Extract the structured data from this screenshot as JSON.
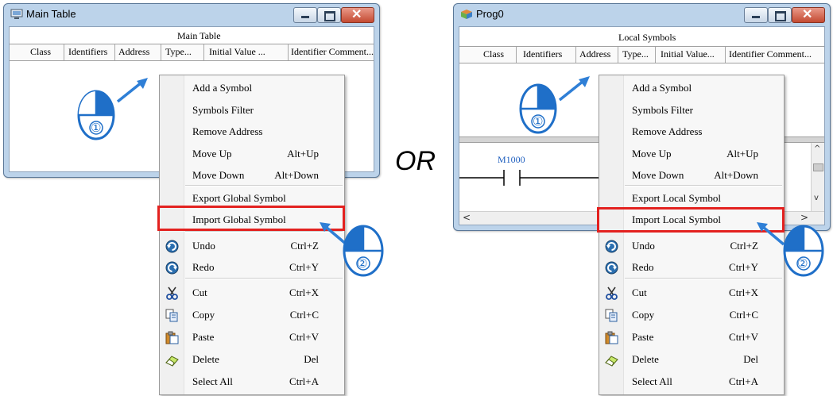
{
  "left_window": {
    "title": "Main Table",
    "header": "Main Table",
    "columns": [
      "Class",
      "Identifiers",
      "Address",
      "Type...",
      "Initial Value ...",
      "Identifier Comment..."
    ]
  },
  "right_window": {
    "title": "Prog0",
    "header": "Local Symbols",
    "columns": [
      "Class",
      "Identifiers",
      "Address",
      "Type...",
      "Initial Value...",
      "Identifier Comment..."
    ],
    "ladder_label": "M1000"
  },
  "separator_text": "OR",
  "left_menu": {
    "items": [
      {
        "label": "Add a Symbol",
        "shortcut": ""
      },
      {
        "label": "Symbols Filter",
        "shortcut": ""
      },
      {
        "label": "Remove Address",
        "shortcut": ""
      },
      {
        "label": "Move Up",
        "shortcut": "Alt+Up"
      },
      {
        "label": "Move Down",
        "shortcut": "Alt+Down"
      },
      {
        "label": "Export Global Symbol",
        "shortcut": ""
      },
      {
        "label": "Import Global Symbol",
        "shortcut": ""
      },
      {
        "label": "Undo",
        "shortcut": "Ctrl+Z",
        "icon": "undo-icon"
      },
      {
        "label": "Redo",
        "shortcut": "Ctrl+Y",
        "icon": "redo-icon"
      },
      {
        "label": "Cut",
        "shortcut": "Ctrl+X",
        "icon": "scissors-icon"
      },
      {
        "label": "Copy",
        "shortcut": "Ctrl+C",
        "icon": "copy-icon"
      },
      {
        "label": "Paste",
        "shortcut": "Ctrl+V",
        "icon": "paste-icon"
      },
      {
        "label": "Delete",
        "shortcut": "Del",
        "icon": "eraser-icon"
      },
      {
        "label": "Select All",
        "shortcut": "Ctrl+A"
      }
    ]
  },
  "right_menu": {
    "items": [
      {
        "label": "Add a Symbol",
        "shortcut": ""
      },
      {
        "label": "Symbols Filter",
        "shortcut": ""
      },
      {
        "label": "Remove Address",
        "shortcut": ""
      },
      {
        "label": "Move Up",
        "shortcut": "Alt+Up"
      },
      {
        "label": "Move Down",
        "shortcut": "Alt+Down"
      },
      {
        "label": "Export Local Symbol",
        "shortcut": ""
      },
      {
        "label": "Import Local Symbol",
        "shortcut": ""
      },
      {
        "label": "Undo",
        "shortcut": "Ctrl+Z",
        "icon": "undo-icon"
      },
      {
        "label": "Redo",
        "shortcut": "Ctrl+Y",
        "icon": "redo-icon"
      },
      {
        "label": "Cut",
        "shortcut": "Ctrl+X",
        "icon": "scissors-icon"
      },
      {
        "label": "Copy",
        "shortcut": "Ctrl+C",
        "icon": "copy-icon"
      },
      {
        "label": "Paste",
        "shortcut": "Ctrl+V",
        "icon": "paste-icon"
      },
      {
        "label": "Delete",
        "shortcut": "Del",
        "icon": "eraser-icon"
      },
      {
        "label": "Select All",
        "shortcut": "Ctrl+A"
      }
    ]
  },
  "step_badges": [
    "①",
    "②"
  ],
  "colors": {
    "highlight": "#e3211f",
    "arrow": "#2f7fd6",
    "badge": "#1f6fc8",
    "ladder_label": "#1f5fbf"
  }
}
